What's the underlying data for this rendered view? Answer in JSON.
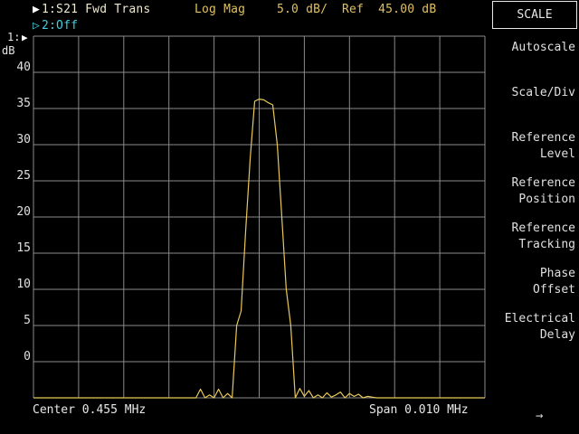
{
  "header": {
    "trace1": {
      "marker": "▶",
      "label": "1:S21 Fwd Trans",
      "format": "Log Mag",
      "scale": "5.0 dB/",
      "ref": "Ref  45.00 dB"
    },
    "trace2": {
      "marker": "▷",
      "label": "2:Off"
    }
  },
  "axis": {
    "ref_marker_label": "1:",
    "ref_marker_arrow": "▶",
    "unit": "dB",
    "y_tick_labels": [
      "40",
      "35",
      "30",
      "25",
      "20",
      "15",
      "10",
      "5",
      "0"
    ]
  },
  "footer": {
    "center": "Center 0.455 MHz",
    "span": "Span 0.010 MHz"
  },
  "menu": {
    "title": "SCALE",
    "items": [
      {
        "lines": [
          "Autoscale"
        ]
      },
      {
        "lines": [
          "Scale/Div"
        ]
      },
      {
        "lines": [
          "Reference",
          "Level"
        ]
      },
      {
        "lines": [
          "Reference",
          "Position"
        ]
      },
      {
        "lines": [
          "Reference",
          "Tracking"
        ]
      },
      {
        "lines": [
          "Phase",
          "Offset"
        ]
      },
      {
        "lines": [
          "Electrical",
          "Delay"
        ]
      }
    ],
    "next_arrow": "→"
  },
  "colors": {
    "trace": "#e8c85a",
    "grid": "#8a8a8a",
    "background": "#000000",
    "trace1_text": "#ece8d0",
    "trace2_text": "#40d0e0"
  },
  "chart_data": {
    "type": "line",
    "ylabel": "dB",
    "ylim": [
      -5,
      45
    ],
    "xlim": [
      0.45,
      0.46
    ],
    "grid": true,
    "series": [
      {
        "x": [
          0.45,
          0.4536,
          0.4537,
          0.4538,
          0.4539,
          0.454,
          0.4541,
          0.4542,
          0.4543,
          0.4544,
          0.4545,
          0.4546,
          0.4547,
          0.4548,
          0.4549,
          0.455,
          0.4551,
          0.4552,
          0.4553,
          0.4554,
          0.4555,
          0.4556,
          0.4557,
          0.4558,
          0.4559,
          0.456,
          0.4561,
          0.4562,
          0.4563,
          0.4564,
          0.4565,
          0.4566,
          0.4567,
          0.4568,
          0.4569,
          0.457,
          0.4571,
          0.4572,
          0.4573,
          0.4574,
          0.4575,
          0.4576,
          0.4577,
          0.4578,
          0.46
        ],
        "y": [
          -5,
          -5,
          -3.8,
          -5,
          -4.6,
          -5,
          -3.8,
          -5,
          -4.4,
          -5,
          5,
          7,
          18,
          28,
          36,
          36.3,
          36.2,
          35.8,
          35.5,
          30,
          20,
          10,
          5,
          -5,
          -3.7,
          -4.8,
          -4.0,
          -5,
          -4.6,
          -5,
          -4.3,
          -4.9,
          -4.6,
          -4.2,
          -5,
          -4.4,
          -4.8,
          -4.5,
          -5,
          -4.8,
          -4.9,
          -5,
          -5,
          -5,
          -5
        ]
      }
    ]
  }
}
